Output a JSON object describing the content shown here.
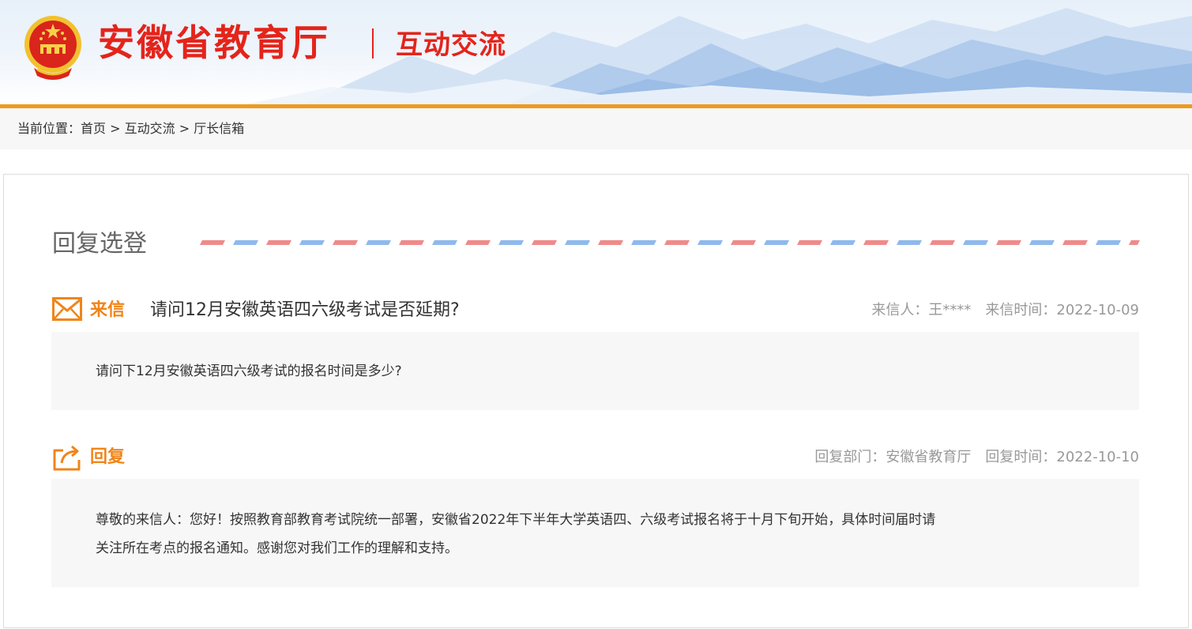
{
  "header": {
    "site_name": "安徽省教育厅",
    "section_name": "互动交流",
    "brand_color": "#e4241b",
    "accent_bar_color": "#ef9a1c",
    "emblem_icon": "national-emblem-icon"
  },
  "breadcrumb": {
    "prefix": "当前位置：",
    "items": [
      "首页",
      "互动交流",
      "厅长信箱"
    ],
    "separator": " > "
  },
  "reply_section": {
    "title": "回复选登",
    "divider_colors": [
      "#f08a8a",
      "#8fb9ec"
    ]
  },
  "letter": {
    "icon": "envelope-icon",
    "label": "来信",
    "subject": "请问12月安徽英语四六级考试是否延期?",
    "sender_label": "来信人：",
    "sender": "王****",
    "time_label": "来信时间：",
    "time": "2022-10-09",
    "body": "请问下12月安徽英语四六级考试的报名时间是多少?"
  },
  "reply": {
    "icon": "share-reply-icon",
    "label": "回复",
    "dept_label": "回复部门：",
    "dept": "安徽省教育厅",
    "time_label": "回复时间：",
    "time": "2022-10-10",
    "body_lines": [
      "尊敬的来信人：您好！按照教育部教育考试院统一部署，安徽省2022年下半年大学英语四、六级考试报名将于十月下旬开始，具体时间届时请",
      "关注所在考点的报名通知。感谢您对我们工作的理解和支持。"
    ]
  },
  "colors": {
    "label_orange": "#f08519",
    "meta_gray": "#999999"
  }
}
